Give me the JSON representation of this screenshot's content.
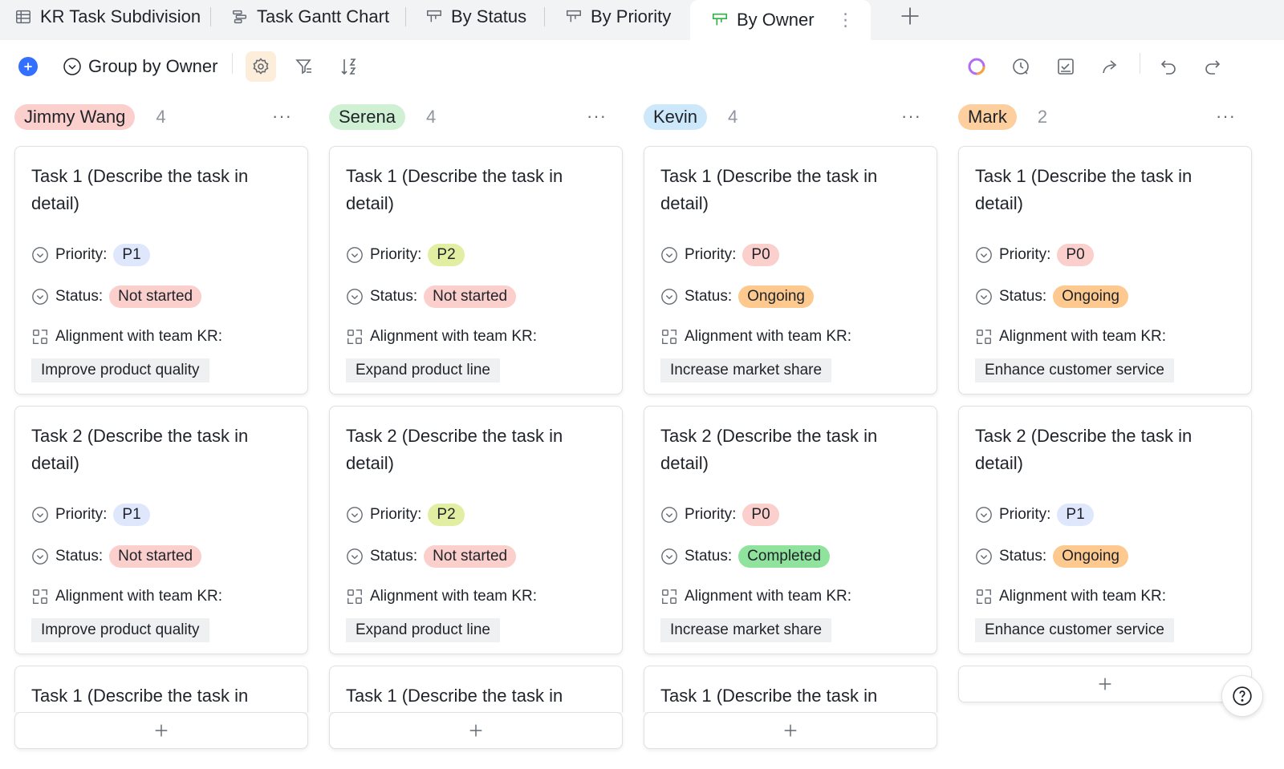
{
  "tabs": [
    {
      "label": "KR Task Subdivision",
      "icon": "grid-table-icon",
      "active": false
    },
    {
      "label": "Task Gantt Chart",
      "icon": "gantt-icon",
      "active": false
    },
    {
      "label": "By Status",
      "icon": "kanban-icon",
      "active": false
    },
    {
      "label": "By Priority",
      "icon": "kanban-icon",
      "active": false
    },
    {
      "label": "By Owner",
      "icon": "kanban-icon",
      "active": true
    }
  ],
  "toolbar": {
    "group_by_label": "Group by Owner"
  },
  "field_labels": {
    "priority": "Priority:",
    "status": "Status:",
    "kr": "Alignment with team KR:"
  },
  "colors": {
    "accent": "#3370ff",
    "active_tab_icon": "#2fb344"
  },
  "columns": [
    {
      "owner": "Jimmy Wang",
      "count": "4",
      "tag_color": "#fbcfcc",
      "cards": [
        {
          "title": "Task 1 (Describe the task in detail)",
          "priority": "P1",
          "status": "Not started",
          "kr": "Improve product quality"
        },
        {
          "title": "Task 2 (Describe the task in detail)",
          "priority": "P1",
          "status": "Not started",
          "kr": "Improve product quality"
        },
        {
          "title": "Task 1 (Describe the task in"
        }
      ]
    },
    {
      "owner": "Serena",
      "count": "4",
      "tag_color": "#d0f0d4",
      "cards": [
        {
          "title": "Task 1 (Describe the task in detail)",
          "priority": "P2",
          "status": "Not started",
          "kr": "Expand product line"
        },
        {
          "title": "Task 2 (Describe the task in detail)",
          "priority": "P2",
          "status": "Not started",
          "kr": "Expand product line"
        },
        {
          "title": "Task 1 (Describe the task in"
        }
      ]
    },
    {
      "owner": "Kevin",
      "count": "4",
      "tag_color": "#cce8fa",
      "cards": [
        {
          "title": "Task 1 (Describe the task in detail)",
          "priority": "P0",
          "status": "Ongoing",
          "kr": "Increase market share"
        },
        {
          "title": "Task 2 (Describe the task in detail)",
          "priority": "P0",
          "status": "Completed",
          "kr": "Increase market share"
        },
        {
          "title": "Task 1 (Describe the task in"
        }
      ]
    },
    {
      "owner": "Mark",
      "count": "2",
      "tag_color": "#fdcf9f",
      "cards": [
        {
          "title": "Task 1 (Describe the task in detail)",
          "priority": "P0",
          "status": "Ongoing",
          "kr": "Enhance customer service"
        },
        {
          "title": "Task 2 (Describe the task in detail)",
          "priority": "P1",
          "status": "Ongoing",
          "kr": "Enhance customer service"
        }
      ]
    }
  ],
  "pill_colors": {
    "P0": "#fbcfcc",
    "P1": "#dfe7fd",
    "P2": "#e2efa3",
    "Not started": "#fbcfcc",
    "Ongoing": "#fdc98f",
    "Completed": "#8fe39c"
  }
}
